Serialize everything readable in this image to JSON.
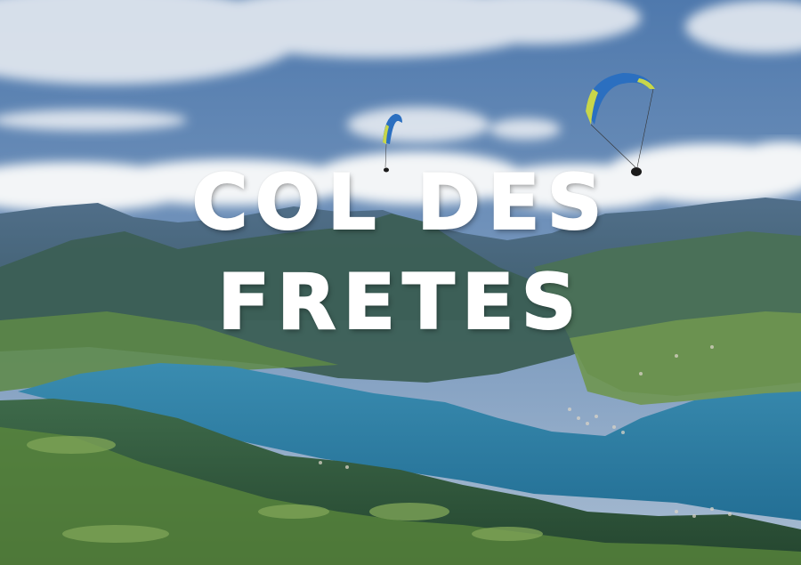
{
  "title": {
    "line1": "COL DES",
    "line2": "FRETES"
  },
  "colors": {
    "sky_top": "#4f79ad",
    "sky_bottom": "#9fb7cf",
    "cloud": "#f2f4f6",
    "mountain_far": "#4a6d8c",
    "mountain_near": "#2f5a48",
    "lake": "#2e7fa3",
    "valley_green": "#5f8a3e",
    "wing_blue": "#2b6fc0",
    "wing_yellow": "#c8d64a",
    "title_text": "#ffffff"
  },
  "icons": [
    "paraglider-icon",
    "paraglider-icon"
  ]
}
